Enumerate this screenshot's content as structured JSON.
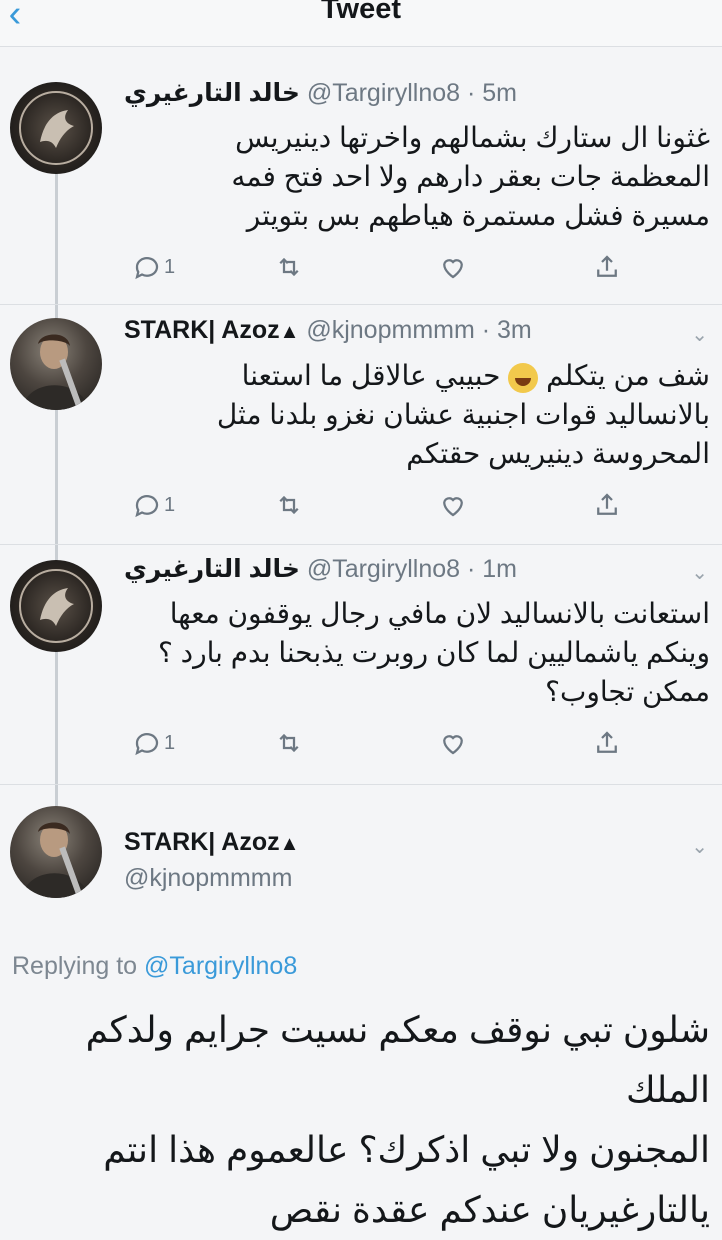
{
  "header": {
    "title": "Tweet",
    "back_icon": "chevron-left-icon"
  },
  "tweets": [
    {
      "name": "خالد التارغيري",
      "handle": "@Targiryllno8",
      "time": "· 5m",
      "lines": [
        "غثونا ال ستارك بشمالهم واخرتها دينيريس",
        "المعظمة جات بعقر دارهم ولا احد فتح فمه",
        "مسيرة فشل مستمرة هياطهم بس بتويتر"
      ],
      "reply_count": "1"
    },
    {
      "name": "STARK| Azoz",
      "handle": "@kjnopmmmm",
      "time": "· 3m",
      "lines": [
        "شف من يتكلم",
        "حبيبي عالاقل ما استعنا",
        "بالانساليد قوات اجنبية عشان نغزو بلدنا مثل",
        "المحروسة دينيريس حقتكم"
      ],
      "reply_count": "1"
    },
    {
      "name": "خالد التارغيري",
      "handle": "@Targiryllno8",
      "time": "· 1m",
      "lines": [
        "استعانت بالانساليد لان مافي رجال يوقفون معها",
        "وينكم ياشماليين لما كان روبرت يذبحنا بدم بارد ؟",
        "ممكن تجاوب؟"
      ],
      "reply_count": "1"
    }
  ],
  "main_tweet": {
    "name": "STARK| Azoz",
    "handle": "@kjnopmmmm",
    "replying_prefix": "Replying to",
    "replying_to": "@Targiryllno8",
    "lines": [
      "شلون تبي نوقف معكم نسيت جرايم ولدكم الملك",
      "المجنون ولا تبي اذكرك؟ عالعموم هذا انتم",
      "يالتارغيريان عندكم عقدة نقص"
    ]
  },
  "icons": [
    "reply-icon",
    "retweet-icon",
    "like-icon",
    "share-icon",
    "chevron-down-icon",
    "wolf-icon",
    "laughing-emoji-icon"
  ],
  "colors": {
    "accent": "#3a9ad9",
    "secondary_text": "#6d7883"
  }
}
